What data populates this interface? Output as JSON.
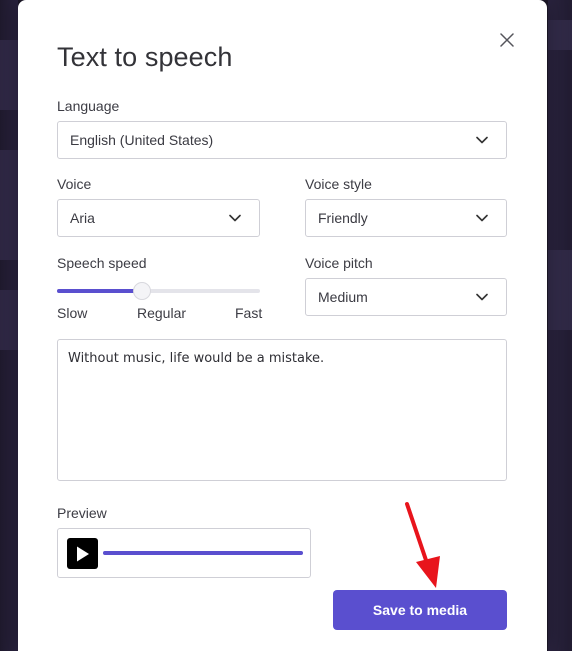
{
  "dialog": {
    "title": "Text to speech"
  },
  "language": {
    "label": "Language",
    "value": "English (United States)"
  },
  "voice": {
    "label": "Voice",
    "value": "Aria"
  },
  "voice_style": {
    "label": "Voice style",
    "value": "Friendly"
  },
  "speech_speed": {
    "label": "Speech speed",
    "level": 0.42,
    "ticks": [
      "Slow",
      "Regular",
      "Fast"
    ]
  },
  "voice_pitch": {
    "label": "Voice pitch",
    "value": "Medium"
  },
  "text_input": {
    "value": "Without music, life would be a mistake."
  },
  "preview": {
    "label": "Preview",
    "progress": 1.0
  },
  "actions": {
    "save_label": "Save to media"
  },
  "colors": {
    "accent": "#5a4fcf",
    "annotation_arrow": "#e8141c"
  },
  "icons": {
    "close": "close-icon",
    "chevron": "chevron-down-icon",
    "play": "play-icon"
  }
}
